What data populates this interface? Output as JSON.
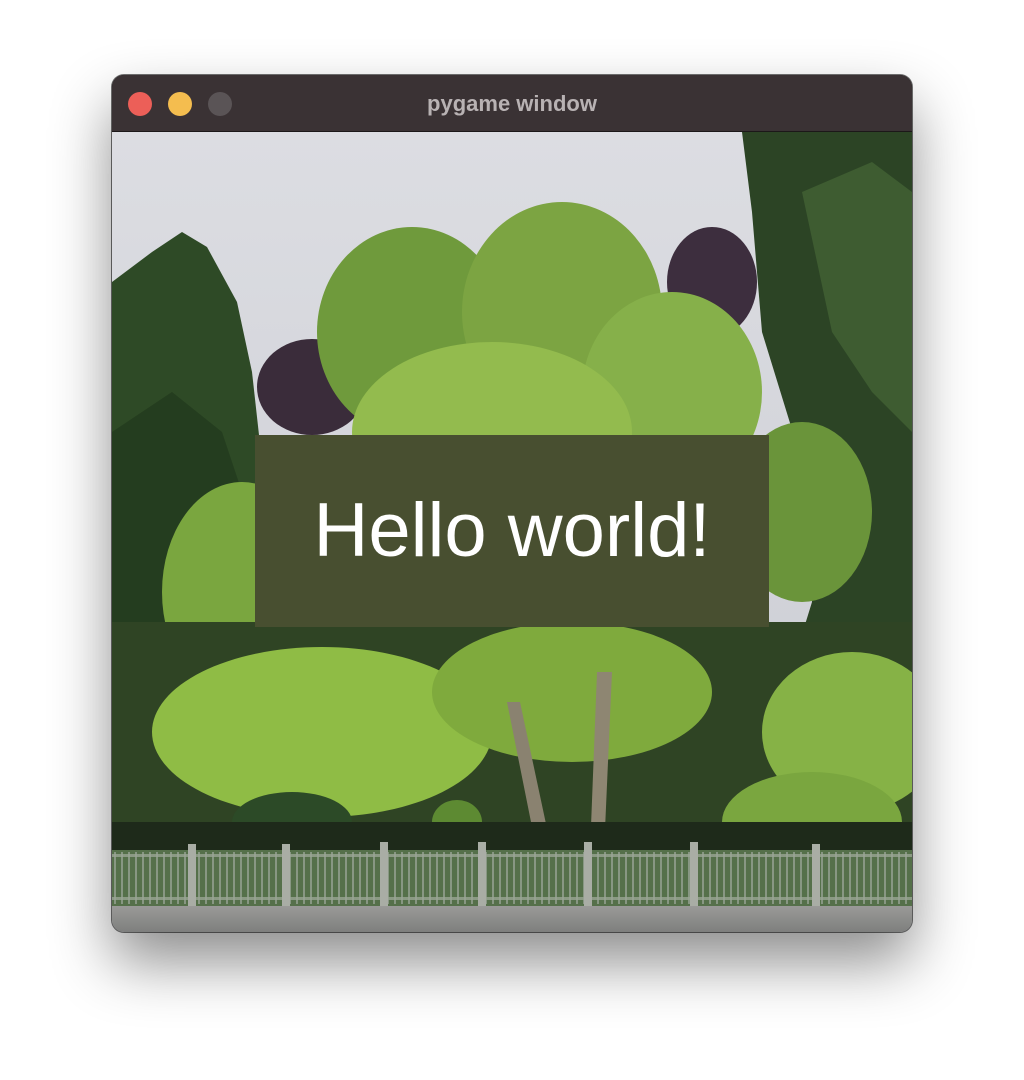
{
  "window": {
    "title": "pygame window"
  },
  "content": {
    "message": "Hello world!",
    "box_color": "#484f30",
    "text_color": "#ffffff",
    "background_image": "park-trees-fence-photo"
  },
  "controls": {
    "close_color": "#ec5f58",
    "minimize_color": "#f4bd4f",
    "maximize_color": "#5a5456"
  }
}
